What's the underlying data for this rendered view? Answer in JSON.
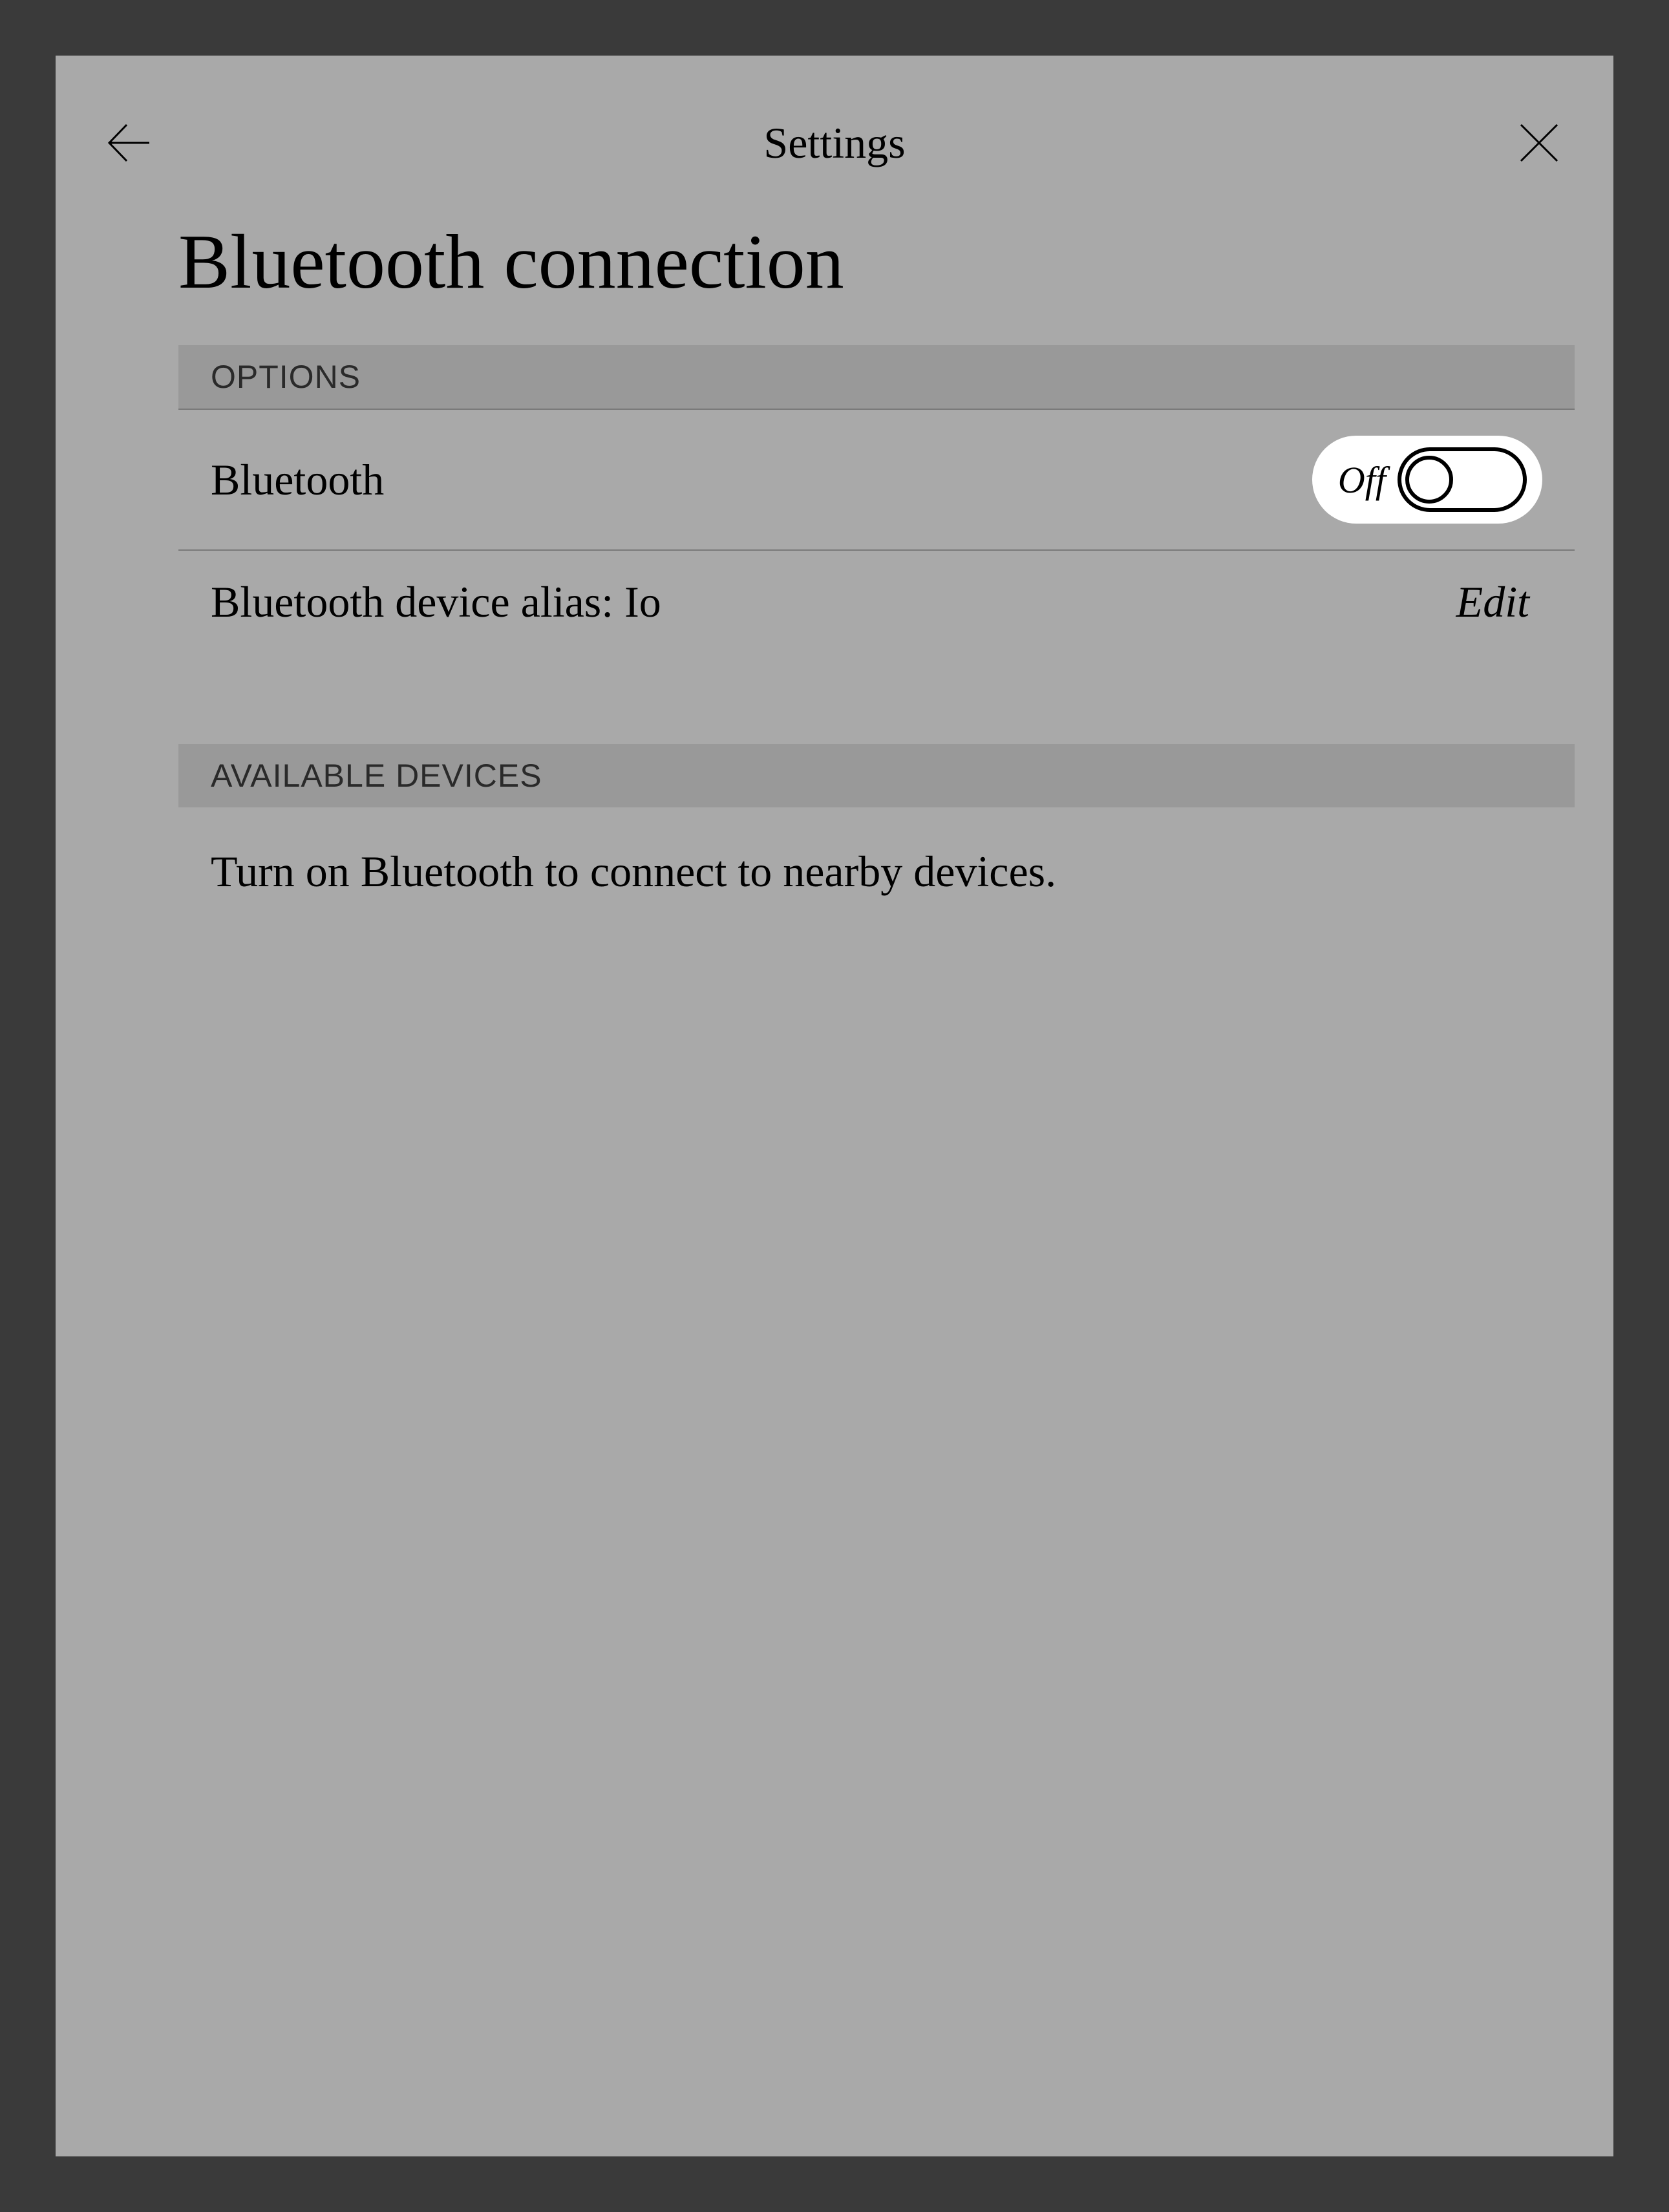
{
  "header": {
    "title": "Settings"
  },
  "page": {
    "title": "Bluetooth connection"
  },
  "sections": {
    "options": {
      "header": "OPTIONS",
      "bluetooth_label": "Bluetooth",
      "bluetooth_toggle_state": "Off",
      "alias_label": "Bluetooth device alias: Io",
      "alias_action": "Edit"
    },
    "available": {
      "header": "AVAILABLE DEVICES",
      "empty_message": "Turn on Bluetooth to connect to nearby devices."
    }
  }
}
